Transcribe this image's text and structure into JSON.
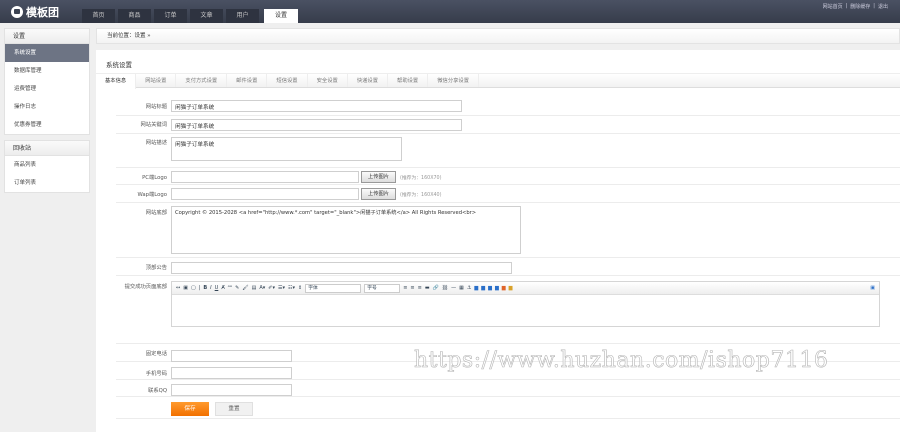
{
  "header": {
    "logo": "模板团",
    "nav": [
      "首页",
      "商品",
      "订单",
      "文章",
      "用户",
      "设置"
    ],
    "active_nav": 5,
    "links": [
      "网站首页",
      "删除缓存",
      "退出"
    ]
  },
  "sidebar": {
    "groups": [
      {
        "title": "设置",
        "items": [
          "系统设置",
          "数据库管理",
          "运费管理",
          "操作日志",
          "优惠券管理"
        ],
        "active": 0
      },
      {
        "title": "回收站",
        "items": [
          "商品列表",
          "订单列表"
        ]
      }
    ]
  },
  "breadcrumb": {
    "label": "当前位置：",
    "path": "设置 »"
  },
  "panel": {
    "title": "系统设置",
    "tabs": [
      "基本信息",
      "网站设置",
      "支付方式设置",
      "邮件设置",
      "短信设置",
      "安全设置",
      "快递设置",
      "帮助设置",
      "微信分享设置"
    ]
  },
  "form": {
    "site_title": {
      "label": "网站标题",
      "value": "闲猫子订单系统"
    },
    "keywords": {
      "label": "网站关键词",
      "value": "闲猫子订单系统"
    },
    "description": {
      "label": "网站描述",
      "value": "闲猫子订单系统"
    },
    "pc_logo": {
      "label": "PC端Logo",
      "value": "",
      "button": "上传图片",
      "hint": "(推荐为：160X70)"
    },
    "wap_logo": {
      "label": "Wap端Logo",
      "value": "",
      "button": "上传图片",
      "hint": "(推荐为：160X40)"
    },
    "footer": {
      "label": "网站底部",
      "value": "Copyright © 2015-2028 <a href=\"http://www.*.com\"  target=\"_blank\">闲猫子订单系统</a> All Rights Reserved<br>"
    },
    "notice": {
      "label": "顶部公告",
      "value": ""
    },
    "success_footer": {
      "label": "提交成功页面底部",
      "font_family": "字体",
      "font_size": "字号"
    },
    "phone": {
      "label": "固定电话",
      "value": ""
    },
    "mobile": {
      "label": "手机号码",
      "value": ""
    },
    "qq": {
      "label": "联系QQ",
      "value": ""
    },
    "save": "保存",
    "reset": "重置"
  },
  "watermark": "https://www.huzhan.com/ishop7116"
}
